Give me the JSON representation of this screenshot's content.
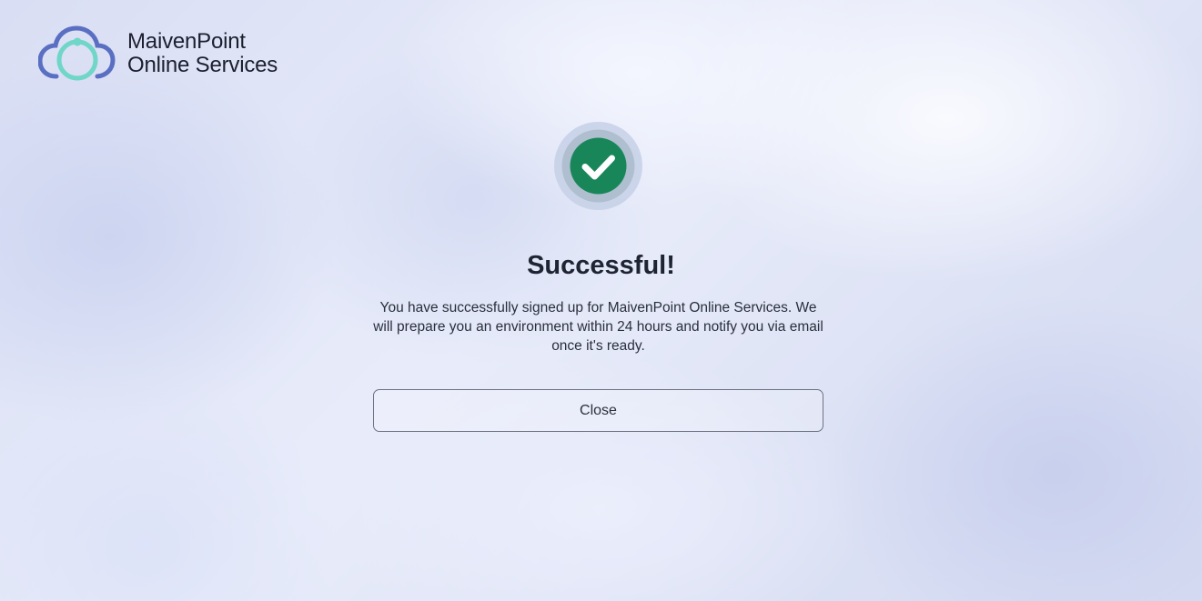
{
  "brand": {
    "line1": "MaivenPoint",
    "line2": "Online Services",
    "logo_icon": "cloud-logo-icon",
    "colors": {
      "cloud": "#5a6fc2",
      "ring": "#6fd6c8",
      "text": "#1b1f2e"
    }
  },
  "status": {
    "icon": "checkmark-circle-icon",
    "color": "#19865a",
    "title": "Successful!",
    "message": "You have successfully signed up for MaivenPoint Online Services. We will prepare you an environment within 24 hours and notify you via email once it's ready."
  },
  "actions": {
    "close_label": "Close"
  }
}
